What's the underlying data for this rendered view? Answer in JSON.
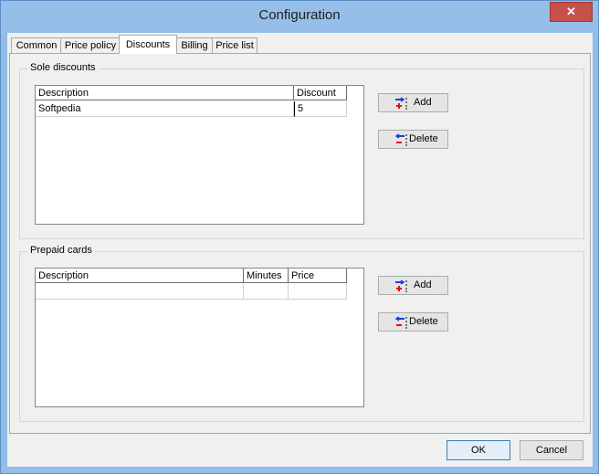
{
  "window": {
    "title": "Configuration",
    "close_glyph": "✕"
  },
  "tabs": [
    {
      "label": "Common",
      "active": false
    },
    {
      "label": "Price policy",
      "active": false
    },
    {
      "label": "Discounts",
      "active": true
    },
    {
      "label": "Billing",
      "active": false
    },
    {
      "label": "Price list",
      "active": false
    }
  ],
  "sole_discounts": {
    "label": "Sole discounts",
    "columns": [
      "Description",
      "Discount"
    ],
    "rows": [
      {
        "description": "Softpedia",
        "discount": "5"
      }
    ],
    "add_label": "Add",
    "delete_label": "Delete"
  },
  "prepaid_cards": {
    "label": "Prepaid cards",
    "columns": [
      "Description",
      "Minutes",
      "Price"
    ],
    "rows": [
      {
        "description": "",
        "minutes": "",
        "price": ""
      }
    ],
    "add_label": "Add",
    "delete_label": "Delete"
  },
  "footer": {
    "ok_label": "OK",
    "cancel_label": "Cancel"
  },
  "icons": {
    "add": "add-row-icon",
    "delete": "delete-row-icon",
    "close": "close-icon"
  },
  "colors": {
    "titlebar": "#95bfe8",
    "close_button": "#c7504a",
    "primary_border": "#3c7fb1"
  }
}
